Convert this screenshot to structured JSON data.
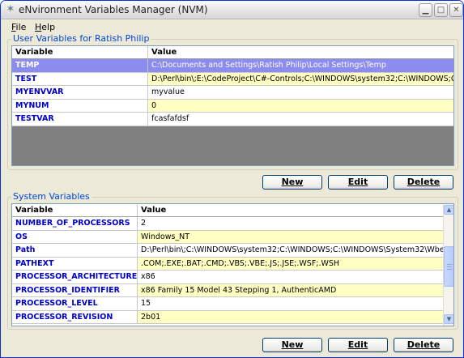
{
  "window": {
    "title": "eNvironment Variables Manager (NVM)"
  },
  "menu": {
    "file": {
      "mnemonic": "F",
      "rest": "ile"
    },
    "help": {
      "mnemonic": "H",
      "rest": "elp"
    }
  },
  "user_vars": {
    "group_title": "User Variables for Ratish Philip",
    "columns": [
      "Variable",
      "Value"
    ],
    "rows": [
      {
        "name": "TEMP",
        "value": "C:\\Documents and Settings\\Ratish Philip\\Local Settings\\Temp",
        "selected": true
      },
      {
        "name": "TEST",
        "value": "D:\\Perl\\bin\\;E:\\CodeProject\\C#-Controls;C:\\WINDOWS\\system32;C:\\WINDOWS;C:..."
      },
      {
        "name": "MYENVVAR",
        "value": "myvalue"
      },
      {
        "name": "MYNUM",
        "value": "0"
      },
      {
        "name": "TESTVAR",
        "value": "fcasfafdsf"
      }
    ],
    "buttons": {
      "new": "New",
      "edit": "Edit",
      "delete": "Delete"
    }
  },
  "system_vars": {
    "group_title": "System Variables",
    "columns": [
      "Variable",
      "Value"
    ],
    "rows": [
      {
        "name": "NUMBER_OF_PROCESSORS",
        "value": "2"
      },
      {
        "name": "OS",
        "value": "Windows_NT"
      },
      {
        "name": "Path",
        "value": "D:\\Perl\\bin\\;C:\\WINDOWS\\system32;C:\\WINDOWS;C:\\WINDOWS\\System32\\Wbe..."
      },
      {
        "name": "PATHEXT",
        "value": ".COM;.EXE;.BAT;.CMD;.VBS;.VBE;.JS;.JSE;.WSF;.WSH"
      },
      {
        "name": "PROCESSOR_ARCHITECTURE",
        "value": "x86"
      },
      {
        "name": "PROCESSOR_IDENTIFIER",
        "value": "x86 Family 15 Model 43 Stepping 1, AuthenticAMD"
      },
      {
        "name": "PROCESSOR_LEVEL",
        "value": "15"
      },
      {
        "name": "PROCESSOR_REVISION",
        "value": "2b01"
      }
    ],
    "buttons": {
      "new": "New",
      "edit": "Edit",
      "delete": "Delete"
    }
  },
  "colors": {
    "group_title": "#0046d5",
    "variable_text": "#0000cc",
    "selected_row": "#8b8bf0",
    "alt_row": "#ffffc4",
    "empty_grid": "#808080"
  }
}
